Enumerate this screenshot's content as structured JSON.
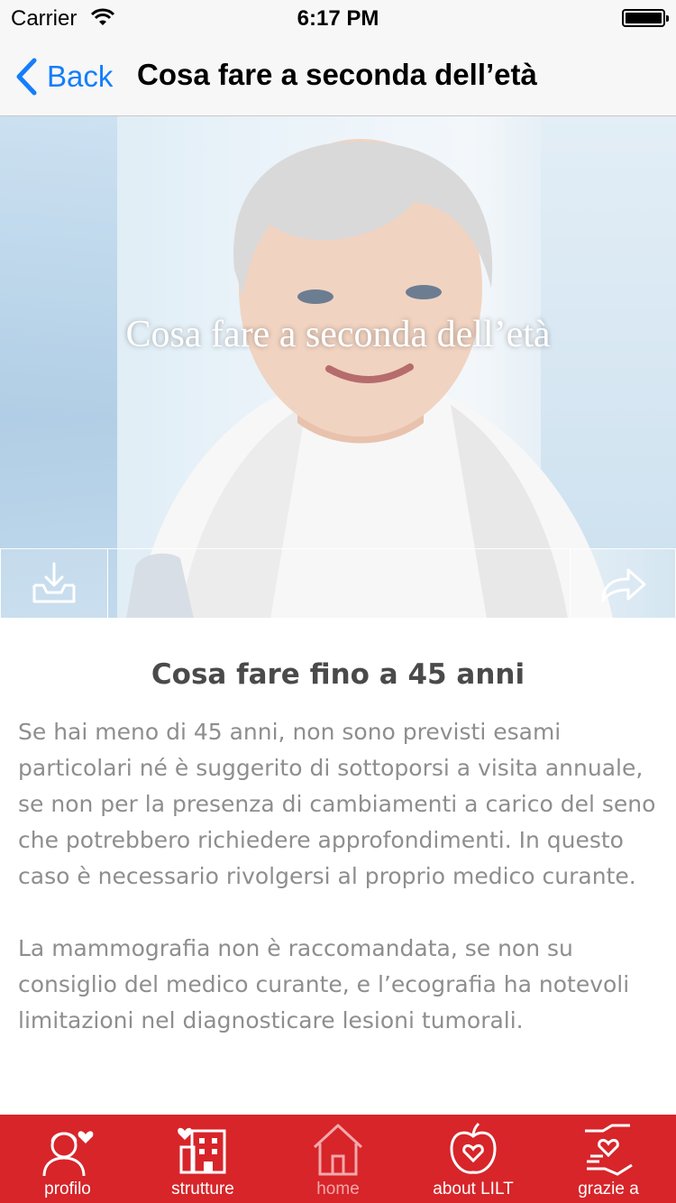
{
  "status_bar": {
    "carrier": "Carrier",
    "time": "6:17 PM"
  },
  "nav": {
    "back_label": "Back",
    "title": "Cosa fare a seconda dell’età"
  },
  "hero": {
    "title": "Cosa fare a seconda dell’età"
  },
  "content": {
    "section_title": "Cosa fare fino a 45 anni",
    "paragraphs": [
      "Se hai meno di 45 anni, non sono previsti esami particolari né è suggerito di sottoporsi a visita annuale, se non per la presenza di cambiamenti a carico del seno che potrebbero richiedere approfondimenti. In questo caso è necessario rivolgersi al proprio medico curante.",
      "La mammografia non è raccomandata, se non su consiglio del medico curante, e l’ecografia ha notevoli limitazioni nel diagnosticare lesioni tumorali."
    ]
  },
  "tabs": [
    {
      "label": "profilo",
      "icon": "profile-heart-icon"
    },
    {
      "label": "strutture",
      "icon": "building-icon"
    },
    {
      "label": "home",
      "icon": "home-icon",
      "active": true
    },
    {
      "label": "about LILT",
      "icon": "apple-heart-icon"
    },
    {
      "label": "grazie a",
      "icon": "hands-heart-icon"
    }
  ],
  "colors": {
    "accent": "#147efb",
    "tab_bar": "#d7252a",
    "active_tab": "#f4a8aa"
  }
}
